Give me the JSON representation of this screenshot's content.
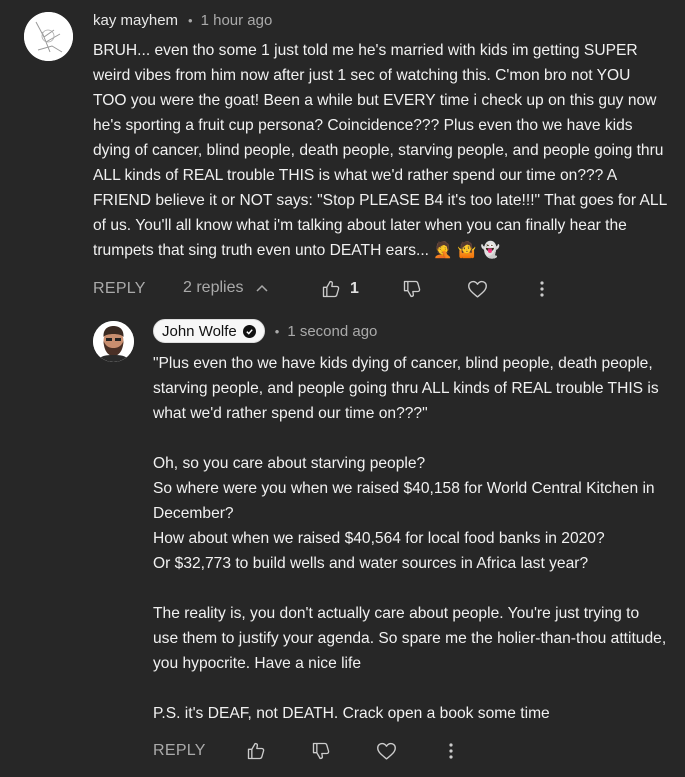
{
  "comment": {
    "author": "kay mayhem",
    "separator": "•",
    "time": "1 hour ago",
    "text": "BRUH... even tho some 1 just told me he's married with kids im getting SUPER\nweird vibes from him now after just 1 sec of watching this. C'mon bro not YOU\nTOO you were the goat! Been a while but EVERY time i check up on this guy now\nhe's sporting a fruit cup persona? Coincidence??? Plus even tho we have kids\ndying of cancer, blind people, death people, starving people, and people going thru\nALL kinds of REAL trouble THIS is what we'd rather spend our time on??? A\nFRIEND believe it or NOT says: \"Stop PLEASE B4 it's too late!!!\" That goes for ALL\nof us. You'll all know what i'm talking about later when you can finally hear the\ntrumpets that sing truth even unto DEATH ears... 🤦 🤷 👻",
    "reply_label": "REPLY",
    "replies_label": "2 replies",
    "like_count": "1",
    "icons": [
      "thumbs-up-icon",
      "thumbs-down-icon",
      "heart-icon",
      "more-vert-icon",
      "chevron-up-icon"
    ]
  },
  "reply": {
    "author": "John Wolfe",
    "separator": "•",
    "time": "1 second ago",
    "text": "\"Plus even tho we have kids dying of cancer, blind people, death people,\nstarving people, and people going thru ALL kinds of REAL trouble THIS is\nwhat we'd rather spend our time on???\"\n\nOh, so you care about starving people?\nSo where were you when we raised $40,158 for World Central Kitchen in\nDecember?\nHow about when we raised $40,564 for local food banks in 2020?\nOr $32,773 to build wells and water sources in Africa last year?\n\nThe reality is, you don't actually care about people. You're just trying to\nuse them to justify your agenda. So spare me the holier-than-thou attitude,\nyou hypocrite. Have a nice life\n\nP.S. it's DEAF, not DEATH. Crack open a book some time",
    "reply_label": "REPLY",
    "icons": [
      "verified-check-icon",
      "thumbs-up-icon",
      "thumbs-down-icon",
      "heart-icon",
      "more-vert-icon"
    ]
  },
  "colors": {
    "background": "#272727",
    "text": "#f1f1f1",
    "muted": "#aaaaaa"
  }
}
